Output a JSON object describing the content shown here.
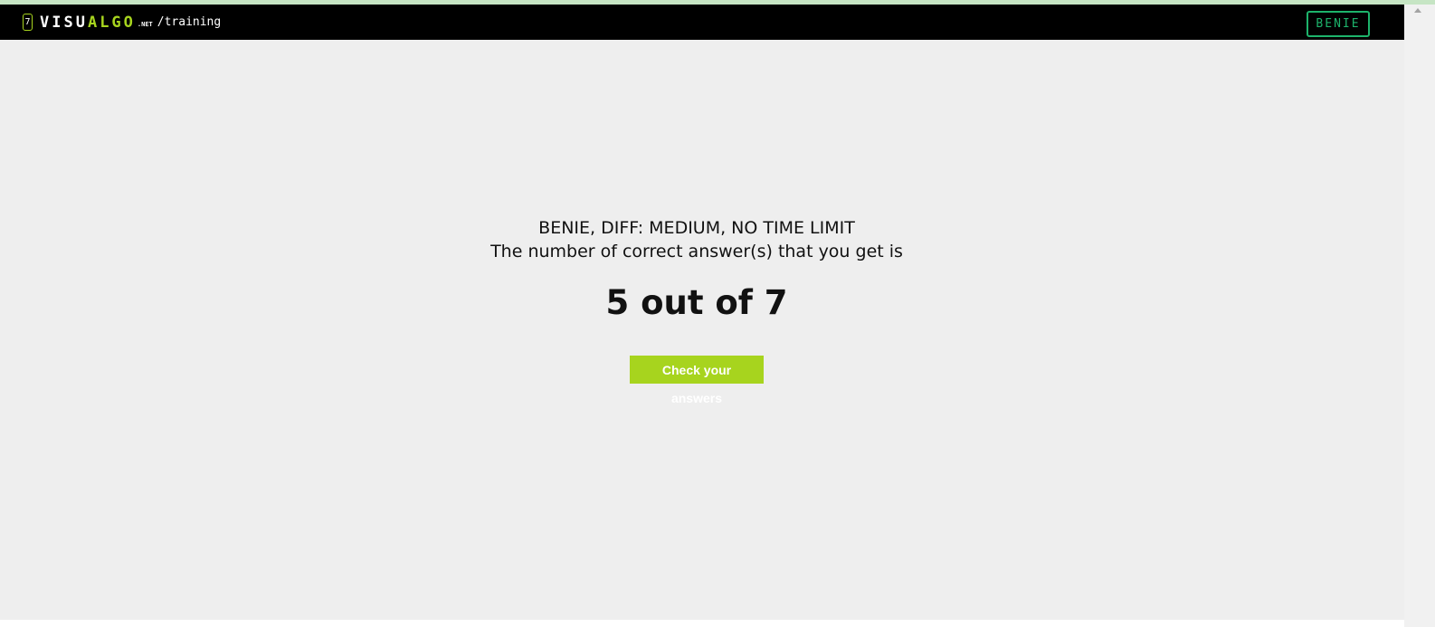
{
  "header": {
    "logo_badge": "7",
    "logo_visu": "VISU",
    "logo_algo": "ALGO",
    "logo_net": ".NET",
    "path": "/training",
    "user_button": "BENIE"
  },
  "results": {
    "subtitle": "BENIE, DIFF: MEDIUM, NO TIME LIMIT",
    "message": "The number of correct answer(s) that you get is",
    "score": "5 out of 7",
    "check_button": "Check your answers"
  },
  "colors": {
    "accent_green": "#a7d41e",
    "user_button_green": "#1db36b",
    "navbar_bg": "#000000",
    "page_bg": "#eeeeee"
  }
}
